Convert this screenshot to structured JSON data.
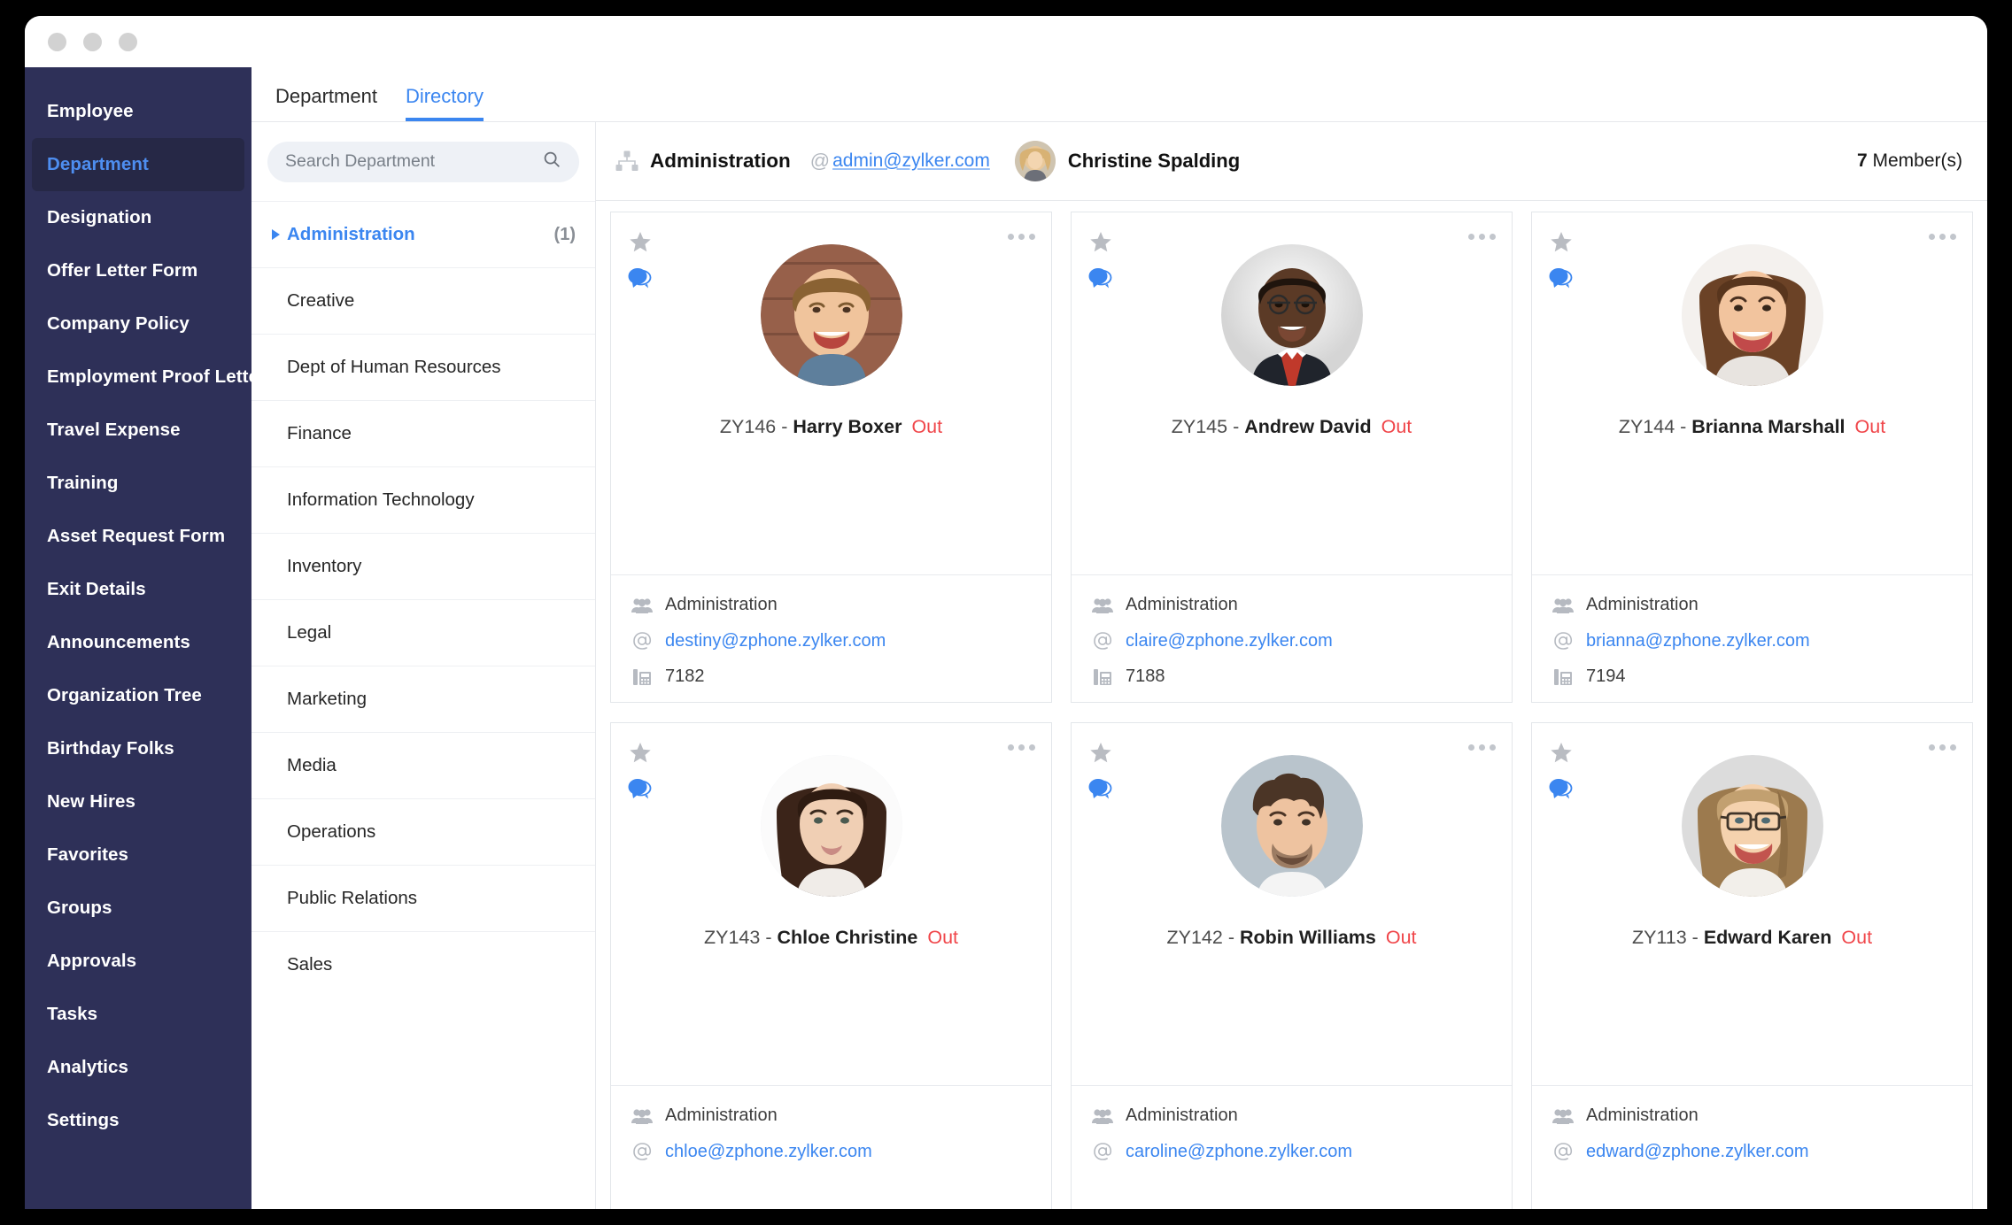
{
  "window": {
    "dots": [
      "close",
      "minimize",
      "maximize"
    ]
  },
  "sidebar": {
    "items": [
      {
        "label": "Employee",
        "active": false
      },
      {
        "label": "Department",
        "active": true
      },
      {
        "label": "Designation",
        "active": false
      },
      {
        "label": "Offer Letter Form",
        "active": false
      },
      {
        "label": "Company Policy",
        "active": false
      },
      {
        "label": "Employment Proof Letter",
        "active": false
      },
      {
        "label": "Travel Expense",
        "active": false
      },
      {
        "label": "Training",
        "active": false
      },
      {
        "label": "Asset Request Form",
        "active": false
      },
      {
        "label": "Exit Details",
        "active": false
      },
      {
        "label": "Announcements",
        "active": false
      },
      {
        "label": "Organization Tree",
        "active": false
      },
      {
        "label": "Birthday Folks",
        "active": false
      },
      {
        "label": "New Hires",
        "active": false
      },
      {
        "label": "Favorites",
        "active": false
      },
      {
        "label": "Groups",
        "active": false
      },
      {
        "label": "Approvals",
        "active": false
      },
      {
        "label": "Tasks",
        "active": false
      },
      {
        "label": "Analytics",
        "active": false
      },
      {
        "label": "Settings",
        "active": false
      }
    ]
  },
  "tabs": [
    {
      "label": "Department",
      "active": false
    },
    {
      "label": "Directory",
      "active": true
    }
  ],
  "search": {
    "placeholder": "Search Department",
    "value": ""
  },
  "departments": [
    {
      "label": "Administration",
      "count": "(1)",
      "selected": true
    },
    {
      "label": "Creative",
      "count": "",
      "selected": false
    },
    {
      "label": "Dept of Human Resources",
      "count": "",
      "selected": false
    },
    {
      "label": "Finance",
      "count": "",
      "selected": false
    },
    {
      "label": "Information Technology",
      "count": "",
      "selected": false
    },
    {
      "label": "Inventory",
      "count": "",
      "selected": false
    },
    {
      "label": "Legal",
      "count": "",
      "selected": false
    },
    {
      "label": "Marketing",
      "count": "",
      "selected": false
    },
    {
      "label": "Media",
      "count": "",
      "selected": false
    },
    {
      "label": "Operations",
      "count": "",
      "selected": false
    },
    {
      "label": "Public Relations",
      "count": "",
      "selected": false
    },
    {
      "label": "Sales",
      "count": "",
      "selected": false
    }
  ],
  "directory_header": {
    "department": "Administration",
    "at_symbol": "@",
    "admin_email": "admin@zylker.com",
    "head_name": "Christine Spalding",
    "member_count_number": "7",
    "member_count_label": " Member(s)"
  },
  "colors": {
    "sidebar_bg": "#2e3058",
    "sidebar_active_bg": "#262846",
    "accent_blue": "#3b86f0",
    "status_red": "#f0464a",
    "card_border": "#e3e6ea"
  },
  "employees": [
    {
      "id": "ZY146",
      "separator": " - ",
      "name": "Harry Boxer",
      "status": "Out",
      "department": "Administration",
      "email": "destiny@zphone.zylker.com",
      "extension": "7182",
      "avatar": "male-blond-brick",
      "star": "star-icon",
      "chat": "chat-icon",
      "menu": "more-options-icon"
    },
    {
      "id": "ZY145",
      "separator": " - ",
      "name": "Andrew David",
      "status": "Out",
      "department": "Administration",
      "email": "claire@zphone.zylker.com",
      "extension": "7188",
      "avatar": "male-suit-tie",
      "star": "star-icon",
      "chat": "chat-icon",
      "menu": "more-options-icon"
    },
    {
      "id": "ZY144",
      "separator": " - ",
      "name": "Brianna Marshall",
      "status": "Out",
      "department": "Administration",
      "email": "brianna@zphone.zylker.com",
      "extension": "7194",
      "avatar": "female-brunette-smile",
      "star": "star-icon",
      "chat": "chat-icon",
      "menu": "more-options-icon"
    },
    {
      "id": "ZY143",
      "separator": " - ",
      "name": "Chloe Christine",
      "status": "Out",
      "department": "Administration",
      "email": "chloe@zphone.zylker.com",
      "extension": "",
      "avatar": "female-dark-hair",
      "star": "star-icon",
      "chat": "chat-icon",
      "menu": "more-options-icon"
    },
    {
      "id": "ZY142",
      "separator": " - ",
      "name": "Robin Williams",
      "status": "Out",
      "department": "Administration",
      "email": "caroline@zphone.zylker.com",
      "extension": "",
      "avatar": "male-messy-hair",
      "star": "star-icon",
      "chat": "chat-icon",
      "menu": "more-options-icon"
    },
    {
      "id": "ZY113",
      "separator": " - ",
      "name": "Edward Karen",
      "status": "Out",
      "department": "Administration",
      "email": "edward@zphone.zylker.com",
      "extension": "",
      "avatar": "female-glasses-blonde",
      "star": "star-icon",
      "chat": "chat-icon",
      "menu": "more-options-icon"
    }
  ]
}
